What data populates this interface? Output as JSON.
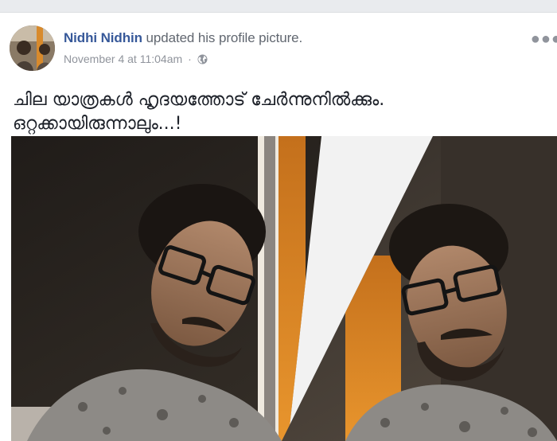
{
  "post": {
    "author": "Nidhi Nidhin",
    "action": "updated his profile picture.",
    "timestamp": "November 4 at 11:04am",
    "separator": "·",
    "privacy_icon": "globe-icon",
    "more_icon": "ellipsis-icon",
    "text_lines": [
      "ചില യാത്രകൾ ഹൃദയത്തോട് ചേർന്നുനിൽക്കും.",
      "ഒറ്റക്കായിരുന്നാലും...!"
    ]
  },
  "colors": {
    "author_link": "#365899",
    "meta_text": "#90949c",
    "body_text": "#1d2129",
    "page_background": "#e9ebee"
  }
}
